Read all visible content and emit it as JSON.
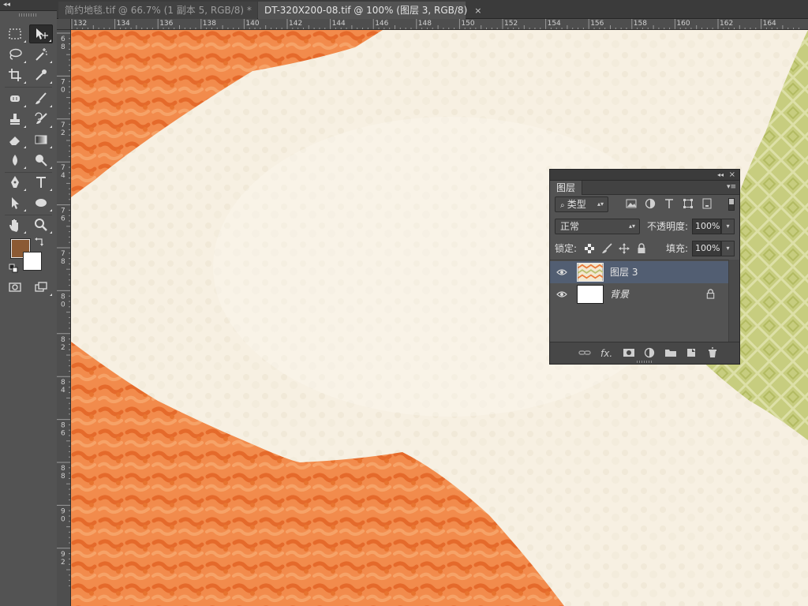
{
  "tabs": [
    {
      "label": "简约地毯.tif @ 66.7% (1 副本 5, RGB/8) *",
      "active": false
    },
    {
      "label": "DT-320X200-08.tif @ 100% (图层 3, RGB/8)",
      "active": true
    }
  ],
  "tab_close_glyph": "×",
  "toolbar": {
    "collapse_glyph": "◂◂",
    "tools": [
      {
        "name": "rectangular-marquee-icon"
      },
      {
        "name": "move-tool-icon"
      },
      {
        "name": "lasso-icon"
      },
      {
        "name": "magic-wand-icon"
      },
      {
        "name": "crop-icon"
      },
      {
        "name": "eyedropper-icon"
      },
      {
        "name": "spot-healing-icon"
      },
      {
        "name": "brush-icon"
      },
      {
        "name": "clone-stamp-icon"
      },
      {
        "name": "history-brush-icon"
      },
      {
        "name": "eraser-icon"
      },
      {
        "name": "gradient-icon"
      },
      {
        "name": "blur-icon"
      },
      {
        "name": "dodge-icon"
      },
      {
        "name": "pen-icon"
      },
      {
        "name": "type-icon",
        "glyph": "T"
      },
      {
        "name": "path-selection-icon"
      },
      {
        "name": "ellipse-icon"
      },
      {
        "name": "hand-icon"
      },
      {
        "name": "zoom-icon"
      },
      {
        "name": "quick-mask-icon"
      },
      {
        "name": "screen-mode-icon"
      }
    ],
    "foreground_color": "#8b5a34",
    "background_color": "#ffffff"
  },
  "ruler": {
    "top_labels": [
      "132",
      "134",
      "136",
      "138",
      "140",
      "142",
      "144",
      "146",
      "148",
      "150",
      "152",
      "154",
      "156",
      "158",
      "160",
      "162",
      "164"
    ],
    "left_labels": [
      "6\n8",
      "7\n0",
      "7\n2",
      "7\n4",
      "7\n6",
      "7\n8",
      "8\n0",
      "8\n2",
      "8\n4",
      "8\n6",
      "8\n8",
      "9\n0",
      "9\n2"
    ]
  },
  "layers_panel": {
    "header_collapse_glyph": "◂◂",
    "header_close_glyph": "×",
    "tab_label": "图层",
    "menu_glyph": "▾≡",
    "filter_kind": "类型",
    "filter_icons": [
      "image-filter-icon",
      "adjustment-filter-icon",
      "type-filter-icon",
      "shape-filter-icon",
      "smart-object-filter-icon"
    ],
    "blend_mode": "正常",
    "opacity_label": "不透明度:",
    "opacity_value": "100%",
    "lock_label": "锁定:",
    "fill_label": "填充:",
    "fill_value": "100%",
    "layers": [
      {
        "name": "图层 3",
        "selected": true,
        "visible": true,
        "locked": false
      },
      {
        "name": "背景",
        "selected": false,
        "visible": true,
        "locked": true
      }
    ],
    "footer_icons": [
      "link-layers-icon",
      "fx-icon",
      "add-mask-icon",
      "adjustment-layer-icon",
      "new-group-icon",
      "new-layer-icon",
      "trash-icon"
    ],
    "fx_label": "fx."
  },
  "colors": {
    "accent_selected_layer": "#525e72",
    "canvas_cream": "#f7f0e1",
    "canvas_orange": "#f08a4a",
    "canvas_green": "#c9cf82"
  }
}
